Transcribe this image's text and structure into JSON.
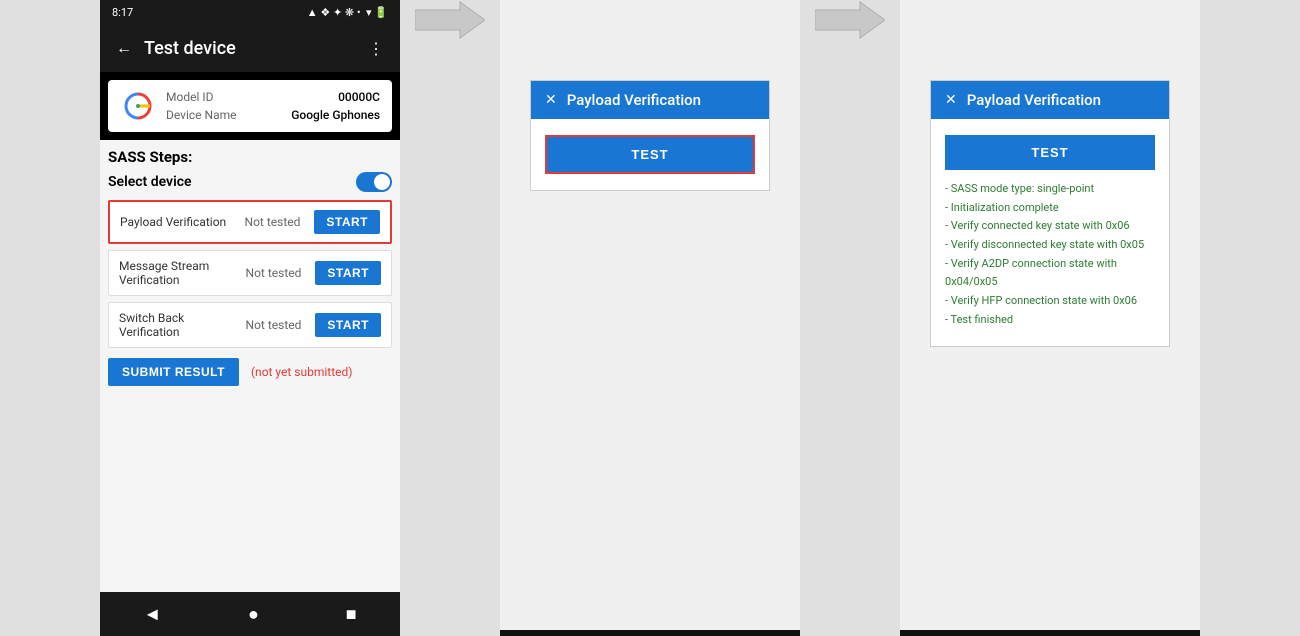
{
  "screen1": {
    "statusBar": {
      "time": "8:17",
      "icons": [
        "sim",
        "wifi",
        "battery"
      ]
    },
    "appBar": {
      "title": "Test device",
      "backIcon": "←",
      "menuIcon": "⋮"
    },
    "deviceInfo": {
      "modelIdLabel": "Model ID",
      "modelIdValue": "00000C",
      "deviceNameLabel": "Device Name",
      "deviceNameValue": "Google Gphones"
    },
    "sassTitle": "SASS Steps:",
    "selectDevice": "Select device",
    "steps": [
      {
        "name": "Payload Verification",
        "status": "Not tested",
        "buttonLabel": "START",
        "highlighted": true
      },
      {
        "name": "Message Stream Verification",
        "status": "Not tested",
        "buttonLabel": "START",
        "highlighted": false
      },
      {
        "name": "Switch Back Verification",
        "status": "Not tested",
        "buttonLabel": "START",
        "highlighted": false
      }
    ],
    "submitButton": "SUBMIT RESULT",
    "submitStatus": "(not yet submitted)"
  },
  "dialog1": {
    "title": "Payload Verification",
    "closeIcon": "✕",
    "testButton": "TEST"
  },
  "dialog2": {
    "title": "Payload Verification",
    "closeIcon": "✕",
    "testButton": "TEST",
    "results": [
      "- SASS mode type: single-point",
      "- Initialization complete",
      "- Verify connected key state with 0x06",
      "- Verify disconnected key state with 0x05",
      "- Verify A2DP connection state with 0x04/0x05",
      "- Verify HFP connection state with 0x06",
      "- Test finished"
    ]
  }
}
